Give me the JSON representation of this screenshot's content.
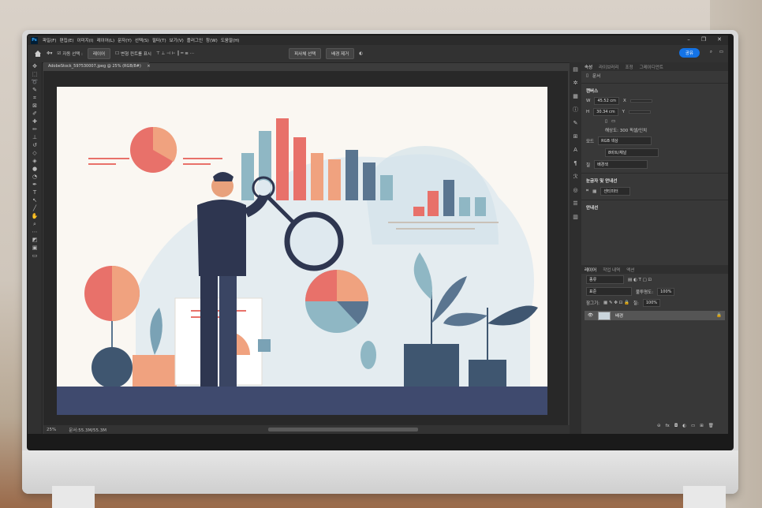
{
  "menubar": {
    "items": [
      "파일(F)",
      "편집(E)",
      "이미지(I)",
      "레이어(L)",
      "문자(Y)",
      "선택(S)",
      "필터(T)",
      "보기(V)",
      "플러그인",
      "창(W)",
      "도움말(H)"
    ]
  },
  "options": {
    "auto_select_label": "자동 선택 :",
    "auto_select_value": "레이어",
    "transform_controls_label": "변형 컨트롤 표시",
    "select_subject": "피사체 선택",
    "remove_background": "배경 제거",
    "share": "공유"
  },
  "document": {
    "tab_title": "AdobeStock_597530007.jpeg @ 25% (RGB/8#)",
    "zoom": "25%",
    "doc_info": "문서:55.3M/55.3M"
  },
  "properties": {
    "tabs": [
      "속성",
      "라이브러리",
      "조정",
      "그레이디언트"
    ],
    "doc_label": "문서",
    "canvas_header": "캔버스",
    "w_label": "W",
    "w_value": "45.52 cm",
    "h_label": "H",
    "h_value": "30.34 cm",
    "x_label": "X",
    "y_label": "Y",
    "resolution": "해상도: 300 픽셀/인치",
    "mode_label": "모드",
    "mode_value": "RGB 색상",
    "bit_value": "8비트/채널",
    "fill_label": "칠",
    "fill_value": "배경색",
    "rulers_header": "눈금자 및 안내선",
    "rulers_value": "센티미터",
    "guides_header": "안내선"
  },
  "layers": {
    "tabs": [
      "레이어",
      "작업 내역",
      "액션"
    ],
    "search_placeholder": "종류",
    "blend_mode": "표준",
    "opacity_label": "불투명도:",
    "opacity_value": "100%",
    "lock_label": "잠그기:",
    "fill_label": "칠:",
    "fill_value": "100%",
    "layer_name": "배경"
  },
  "colors": {
    "ps_blue": "#31a8ff",
    "share_blue": "#1473e6",
    "coral": "#e8716a",
    "salmon": "#f0a27f",
    "teal": "#8fb7c4",
    "slate": "#5a7590",
    "navy": "#2e3650"
  }
}
